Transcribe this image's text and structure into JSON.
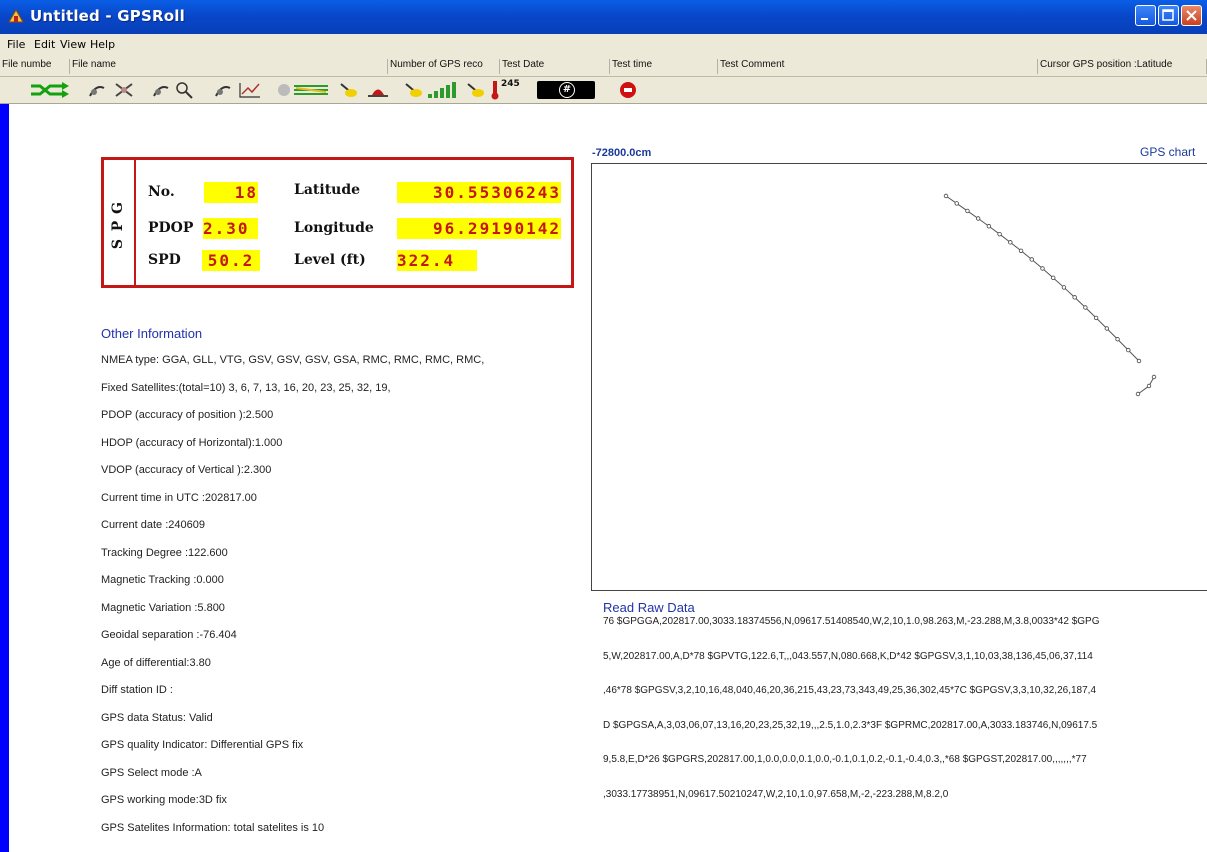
{
  "window": {
    "title": "Untitled - GPSRoll",
    "menu": [
      "File",
      "Edit",
      "View",
      "Help"
    ]
  },
  "header_columns": [
    "File numbe",
    "File name",
    "Number of GPS reco",
    "Test Date",
    "Test time",
    "Test Comment",
    "Cursor GPS position :Latitude"
  ],
  "toolbar": {
    "icons": [
      "shuffle-icon",
      "satellite-tools-icon",
      "satellite-search-icon",
      "satellite-chart-icon",
      "map-layers-icon",
      "dish-icon",
      "tent-icon",
      "signal-bars-icon",
      "thermometer-icon",
      "hash-display-icon",
      "stop-icon"
    ],
    "thermo_value": "245",
    "hash_symbol": "#"
  },
  "gps_panel": {
    "side_letters": [
      "G",
      "P",
      "S"
    ],
    "no_label": "No.",
    "no_value": "18",
    "pdop_label": "PDOP",
    "pdop_value": "2.30",
    "spd_label": "SPD",
    "spd_value": "50.2",
    "lat_label": "Latitude",
    "lat_value": "30.55306243",
    "lon_label": "Longitude",
    "lon_value": "96.29190142",
    "level_label": "Level (ft)",
    "level_value": "322.4"
  },
  "other_info": {
    "heading": "Other Information",
    "lines": [
      "NMEA type: GGA, GLL, VTG, GSV, GSV, GSV, GSA, RMC, RMC, RMC, RMC,",
      "Fixed Satellites:(total=10) 3, 6, 7, 13, 16, 20, 23, 25, 32, 19,",
      "PDOP (accuracy of position  ):2.500",
      "HDOP (accuracy of Horizontal):1.000",
      "VDOP (accuracy of Vertical  ):2.300",
      "Current time in UTC :202817.00",
      "Current date        :240609",
      "Tracking Degree     :122.600",
      "Magnetic Tracking   :0.000",
      "Magnetic Variation  :5.800",
      "Geoidal separation :-76.404",
      "Age of differential:3.80",
      "Diff station ID    :",
      "GPS data Status: Valid",
      "GPS quality Indicator: Differential GPS fix",
      "GPS Select mode :A",
      "GPS working mode:3D fix",
      "GPS Satelites Information: total satelites is 10"
    ]
  },
  "chart": {
    "top_label": "-72800.0cm",
    "title": "GPS chart"
  },
  "raw": {
    "heading": "Read Raw Data",
    "lines": [
      "76  $GPGGA,202817.00,3033.18374556,N,09617.51408540,W,2,10,1.0,98.263,M,-23.288,M,3.8,0033*42  $GPG",
      "5,W,202817.00,A,D*78  $GPVTG,122.6,T,,,043.557,N,080.668,K,D*42  $GPGSV,3,1,10,03,38,136,45,06,37,114",
      ",46*78  $GPGSV,3,2,10,16,48,040,46,20,36,215,43,23,73,343,49,25,36,302,45*7C  $GPGSV,3,3,10,32,26,187,4",
      "D  $GPGSA,A,3,03,06,07,13,16,20,23,25,32,19,,,2.5,1.0,2.3*3F  $GPRMC,202817.00,A,3033.183746,N,09617.5",
      "9,5.8,E,D*26  $GPGRS,202817.00,1,0.0,0.0,0.1,0.0,-0.1,0.1,0.2,-0.1,-0.4,0.3,,*68  $GPGST,202817.00,,,,,,,*77",
      ",3033.17738951,N,09617.50210247,W,2,10,1.0,97.658,M,-2,-223.288,M,8.2,0"
    ]
  },
  "colors": {
    "title_blue": "#0846c8",
    "panel_red": "#c41717",
    "highlight_yellow": "#ffff00",
    "link_blue": "#2233aa",
    "strip_blue": "#0000ff"
  }
}
